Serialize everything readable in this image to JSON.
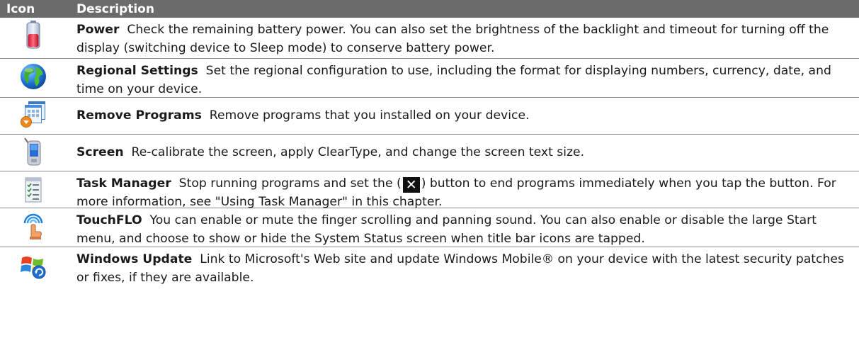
{
  "header": {
    "col_icon": "Icon",
    "col_description": "Description"
  },
  "rows": [
    {
      "icon": "battery-icon",
      "title": "Power",
      "description": "Check the remaining battery power. You can also set the brightness of the backlight and timeout for turning off the display (switching device to Sleep mode) to conserve battery power."
    },
    {
      "icon": "globe-icon",
      "title": "Regional Settings",
      "description": "Set the regional configuration to use, including the format for displaying numbers, currency, date, and time on your device."
    },
    {
      "icon": "remove-programs-icon",
      "title": "Remove Programs",
      "description": "Remove programs that you installed on your device."
    },
    {
      "icon": "screen-device-icon",
      "title": "Screen",
      "description": "Re-calibrate the screen, apply ClearType, and change the screen text size."
    },
    {
      "icon": "task-manager-icon",
      "title": "Task Manager",
      "description_before": "Stop running programs and set the (",
      "inline_icon": "close-x-icon",
      "inline_icon_glyph": "✕",
      "description_after": ") button to end programs immediately when you tap the button. For more information, see \"Using Task Manager\" in this chapter."
    },
    {
      "icon": "touchflo-icon",
      "title": "TouchFLO",
      "description": "You can enable or mute the finger scrolling and panning sound. You can also enable or disable the large Start menu, and choose to show or hide the System Status screen when title bar icons are tapped."
    },
    {
      "icon": "windows-update-icon",
      "title": "Windows Update",
      "description": "Link to Microsoft's Web site and update Windows Mobile® on your device with the latest security patches or fixes, if they are available."
    }
  ]
}
